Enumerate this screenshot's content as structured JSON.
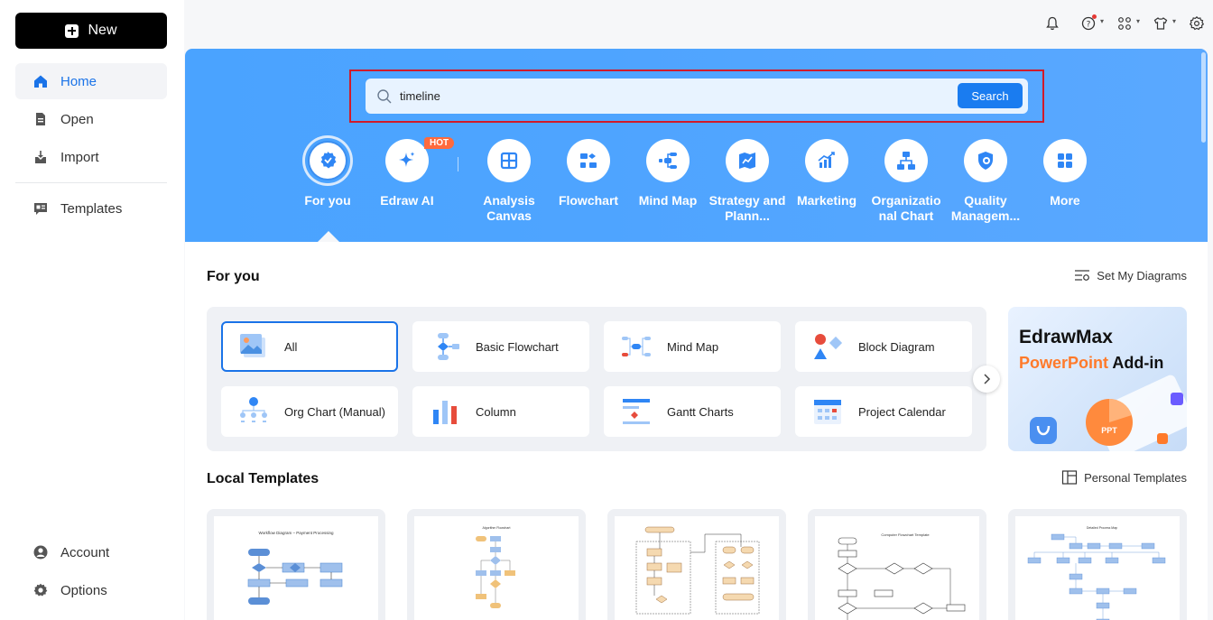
{
  "sidebar": {
    "new_label": "New",
    "items": [
      {
        "label": "Home"
      },
      {
        "label": "Open"
      },
      {
        "label": "Import"
      },
      {
        "label": "Templates"
      }
    ],
    "bottom": [
      {
        "label": "Account"
      },
      {
        "label": "Options"
      }
    ]
  },
  "topbar": {
    "icons": [
      "bell-icon",
      "help-icon",
      "apps-icon",
      "theme-icon",
      "settings-icon"
    ]
  },
  "search": {
    "value": "timeline",
    "button": "Search"
  },
  "categories": [
    {
      "label": "For you",
      "icon": "for-you-icon"
    },
    {
      "label": "Edraw AI",
      "icon": "ai-sparkle-icon",
      "badge": "HOT"
    },
    {
      "label": "Analysis Canvas",
      "icon": "analysis-canvas-icon"
    },
    {
      "label": "Flowchart",
      "icon": "flowchart-icon"
    },
    {
      "label": "Mind Map",
      "icon": "mind-map-icon"
    },
    {
      "label": "Strategy and Plann...",
      "icon": "strategy-icon"
    },
    {
      "label": "Marketing",
      "icon": "marketing-icon"
    },
    {
      "label": "Organizatio nal Chart",
      "icon": "org-chart-icon"
    },
    {
      "label": "Quality Managem...",
      "icon": "quality-icon"
    },
    {
      "label": "More",
      "icon": "more-grid-icon"
    }
  ],
  "for_you": {
    "title": "For you",
    "link": "Set My Diagrams",
    "cards": [
      {
        "label": "All"
      },
      {
        "label": "Basic Flowchart"
      },
      {
        "label": "Mind Map"
      },
      {
        "label": "Block Diagram"
      },
      {
        "label": "Org Chart (Manual)"
      },
      {
        "label": "Column"
      },
      {
        "label": "Gantt Charts"
      },
      {
        "label": "Project Calendar"
      }
    ]
  },
  "banner": {
    "line1": "EdrawMax",
    "line2a": "PowerPoint",
    "line2b": " Add-in",
    "tag": "PPT"
  },
  "local_templates": {
    "title": "Local Templates",
    "link": "Personal Templates",
    "thumbs": [
      {
        "caption": "Workflow Diagram – Payment Processing"
      },
      {
        "caption": "Algorithm Flowchart"
      },
      {
        "caption": ""
      },
      {
        "caption": "Computer Flowchart Template"
      },
      {
        "caption": "Detailed Process Map"
      }
    ]
  },
  "colors": {
    "accent": "#1a73e8",
    "hero": "#4ea4ff",
    "hot": "#ff6a3d",
    "highlight": "#d11a2a"
  }
}
